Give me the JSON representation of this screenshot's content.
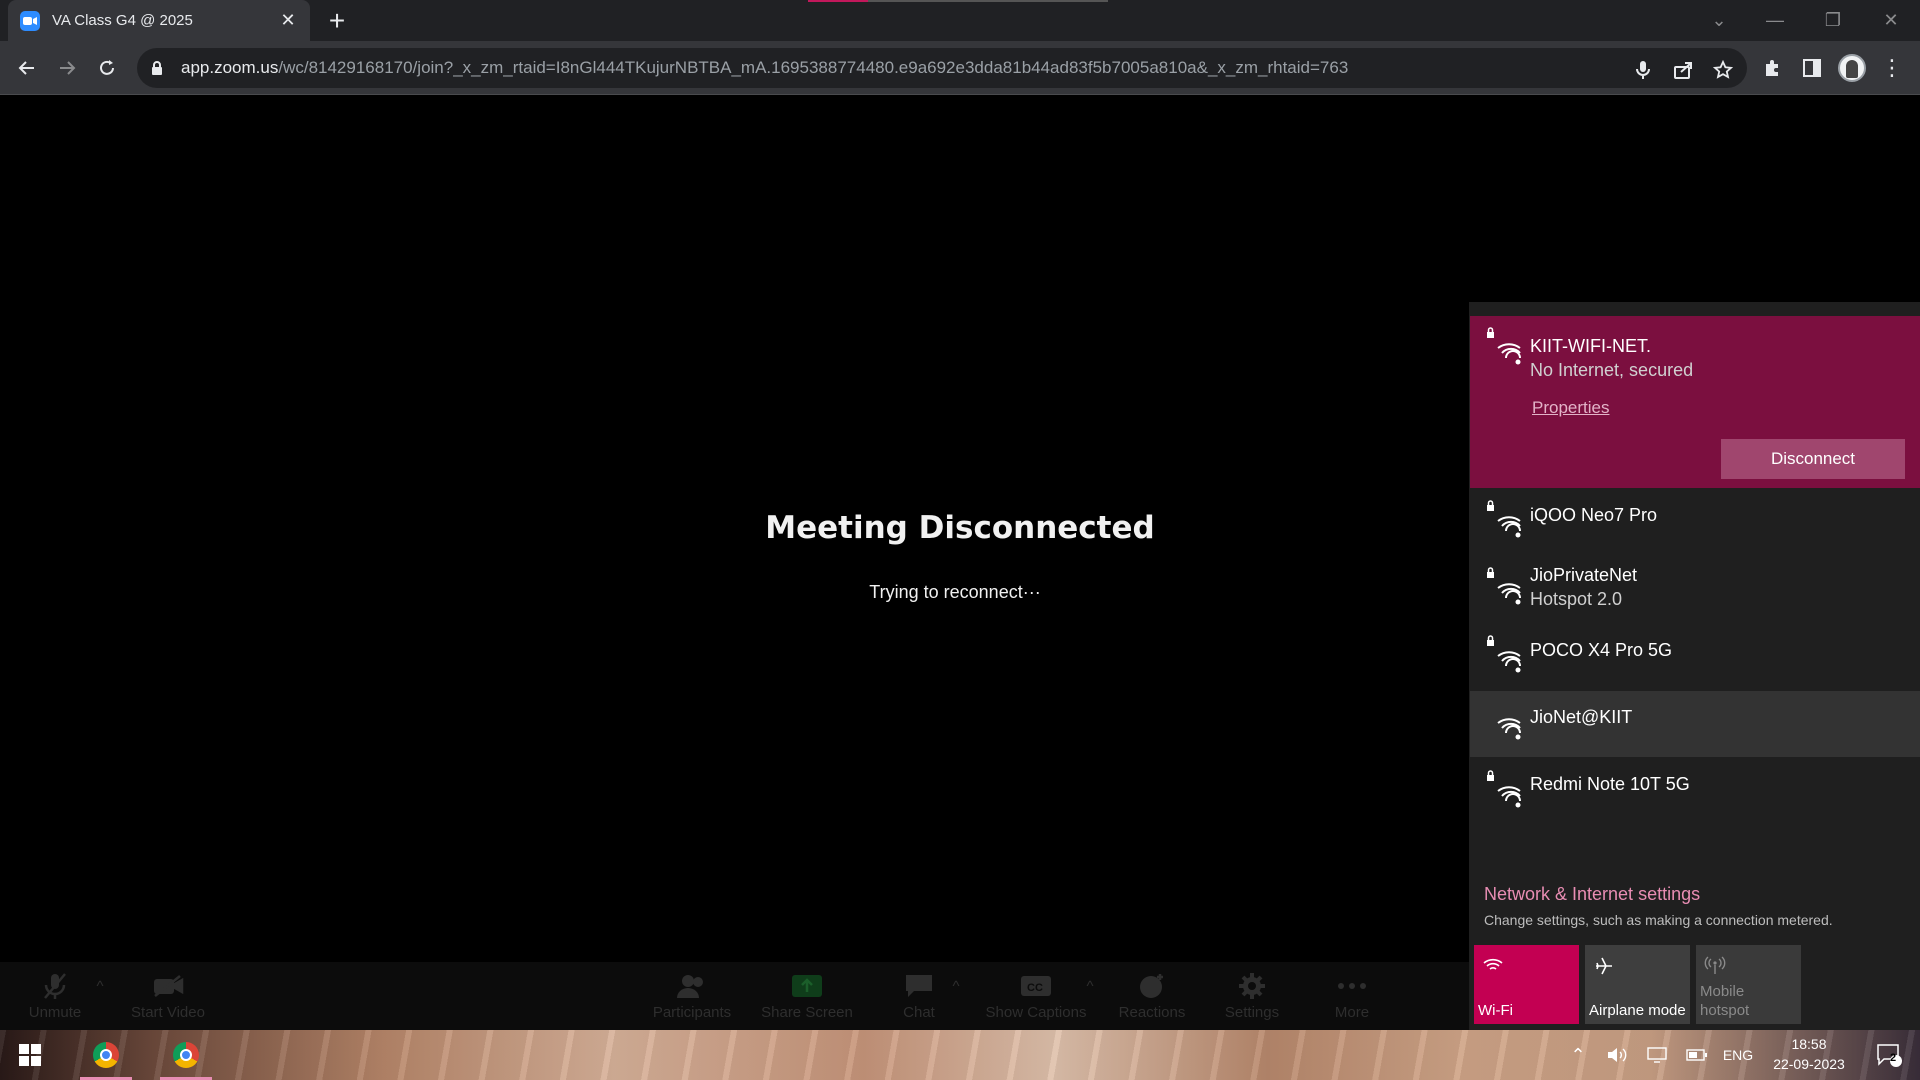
{
  "browser": {
    "tab_title": "VA Class G4 @ 2025",
    "url_host": "app.zoom.us",
    "url_path": "/wc/81429168170/join?_x_zm_rtaid=I8nGl444TKujurNBTBA_mA.1695388774480.e9a692e3dda81b44ad83f5b7005a810a&_x_zm_rhtaid=763",
    "accent": "#2d8cff"
  },
  "meeting": {
    "title": "Meeting Disconnected",
    "subtitle": "Trying to reconnect···"
  },
  "zoom_toolbar": {
    "unmute": "Unmute",
    "start_video": "Start Video",
    "participants": "Participants",
    "share_screen": "Share Screen",
    "chat": "Chat",
    "show_captions": "Show Captions",
    "reactions": "Reactions",
    "settings": "Settings",
    "more": "More"
  },
  "network": {
    "active": {
      "name": "KIIT-WIFI-NET.",
      "status": "No Internet, secured",
      "properties": "Properties",
      "disconnect": "Disconnect"
    },
    "list": [
      {
        "name": "iQOO Neo7 Pro",
        "sub": ""
      },
      {
        "name": "JioPrivateNet",
        "sub": "Hotspot 2.0"
      },
      {
        "name": "POCO X4 Pro 5G",
        "sub": ""
      },
      {
        "name": "JioNet@KIIT",
        "sub": ""
      },
      {
        "name": "Redmi Note 10T 5G",
        "sub": ""
      }
    ],
    "settings_title": "Network & Internet settings",
    "settings_desc": "Change settings, such as making a connection metered.",
    "tiles": {
      "wifi": "Wi-Fi",
      "airplane": "Airplane mode",
      "hotspot_line1": "Mobile",
      "hotspot_line2": "hotspot"
    },
    "accent": "#c30052"
  },
  "taskbar": {
    "lang": "ENG",
    "time": "18:58",
    "date": "22-09-2023",
    "notifications": "2"
  }
}
